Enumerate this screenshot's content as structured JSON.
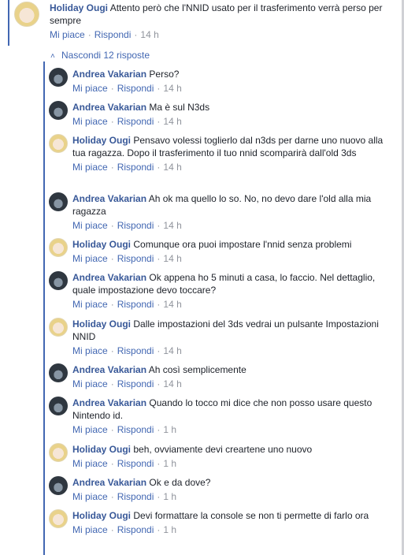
{
  "top_comment": {
    "author": "Holiday Ougi",
    "text": "Attento però che l'NNID usato per il trasferimento verrà perso per sempre",
    "like_label": "Mi piace",
    "reply_label": "Rispondi",
    "time": "14 h"
  },
  "toggle": {
    "label": "Nascondi 12 risposte"
  },
  "replies": [
    {
      "author": "Andrea Vakarian",
      "text": "Perso?",
      "like_label": "Mi piace",
      "reply_label": "Rispondi",
      "time": "14 h"
    },
    {
      "author": "Andrea Vakarian",
      "text": "Ma è sul N3ds",
      "like_label": "Mi piace",
      "reply_label": "Rispondi",
      "time": "14 h"
    },
    {
      "author": "Holiday Ougi",
      "text": "Pensavo volessi toglierlo dal n3ds per darne uno nuovo alla tua ragazza. Dopo il trasferimento il tuo nnid scomparirà dall'old 3ds",
      "like_label": "Mi piace",
      "reply_label": "Rispondi",
      "time": "14 h"
    },
    {
      "author": "Andrea Vakarian",
      "text": "Ah ok ma quello lo so. No, no devo dare l'old alla mia ragazza",
      "like_label": "Mi piace",
      "reply_label": "Rispondi",
      "time": "14 h"
    },
    {
      "author": "Holiday Ougi",
      "text": "Comunque ora puoi impostare l'nnid senza problemi",
      "like_label": "Mi piace",
      "reply_label": "Rispondi",
      "time": "14 h"
    },
    {
      "author": "Andrea Vakarian",
      "text": "Ok appena ho 5 minuti a casa, lo faccio. Nel dettaglio, quale impostazione devo toccare?",
      "like_label": "Mi piace",
      "reply_label": "Rispondi",
      "time": "14 h"
    },
    {
      "author": "Holiday Ougi",
      "text": "Dalle impostazioni del 3ds vedrai un pulsante Impostazioni NNID",
      "like_label": "Mi piace",
      "reply_label": "Rispondi",
      "time": "14 h"
    },
    {
      "author": "Andrea Vakarian",
      "text": "Ah così semplicemente",
      "like_label": "Mi piace",
      "reply_label": "Rispondi",
      "time": "14 h"
    },
    {
      "author": "Andrea Vakarian",
      "text": "Quando lo tocco mi dice che non posso usare questo Nintendo id.",
      "like_label": "Mi piace",
      "reply_label": "Rispondi",
      "time": "1 h"
    },
    {
      "author": "Holiday Ougi",
      "text": "beh, ovviamente devi creartene uno nuovo",
      "like_label": "Mi piace",
      "reply_label": "Rispondi",
      "time": "1 h"
    },
    {
      "author": "Andrea Vakarian",
      "text": "Ok e da dove?",
      "like_label": "Mi piace",
      "reply_label": "Rispondi",
      "time": "1 h"
    },
    {
      "author": "Holiday Ougi",
      "text": "Devi formattare la console se non ti permette di farlo ora",
      "like_label": "Mi piace",
      "reply_label": "Rispondi",
      "time": "1 h"
    }
  ],
  "icons": {
    "toggle_icon": "chevron-up-icon"
  },
  "colors": {
    "link": "#385898",
    "action": "#4267b2",
    "meta": "#90949c",
    "text": "#1d2129"
  }
}
